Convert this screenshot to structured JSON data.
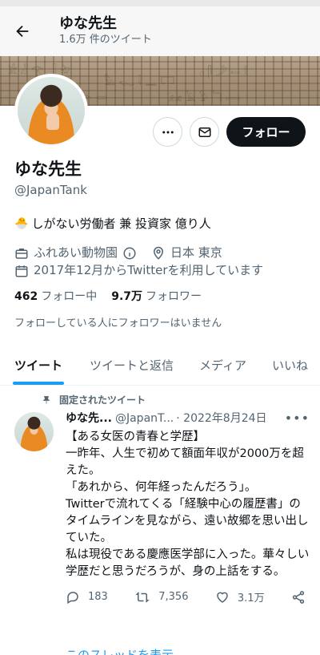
{
  "header": {
    "name": "ゆな先生",
    "tweet_count": "1.6万 件のツイート"
  },
  "profile": {
    "display_name": "ゆな先生",
    "handle": "@JapanTank",
    "bio": "しがない労働者 兼 投資家 億り人",
    "workplace": "ふれあい動物園",
    "location": "日本 東京",
    "joined": "2017年12月からTwitterを利用しています",
    "following_count": "462",
    "following_label": "フォロー中",
    "followers_count": "9.7万",
    "followers_label": "フォロワー",
    "known_followers": "フォローしている人にフォロワーはいません"
  },
  "actions": {
    "follow_label": "フォロー",
    "more_icon": "more-icon",
    "mail_icon": "mail-icon"
  },
  "tabs": [
    {
      "label": "ツイート"
    },
    {
      "label": "ツイートと返信"
    },
    {
      "label": "メディア"
    },
    {
      "label": "いいね"
    }
  ],
  "tweet": {
    "pinned_label": "固定されたツイート",
    "author": "ゆな先...",
    "handle": "@JapanT...",
    "date": "· 2022年8月24日",
    "lines": [
      "【ある女医の青春と学歴】",
      "一昨年、人生で初めて額面年収が2000万を超えた。",
      "「あれから、何年経ったんだろう」。",
      "Twitterで流れてくる「経験中心の履歴書」のタイムラインを見ながら、遠い故郷を思い出していた。",
      "私は現役である慶應医学部に入った。華々しい学歴だと思うだろうが、身の上話をする。"
    ],
    "replies": "183",
    "retweets": "7,356",
    "likes": "3.1万",
    "thread_link": "このスレッドを表示"
  },
  "colors": {
    "accent": "#1d9bf0",
    "text": "#0f1419",
    "secondary": "#536471"
  }
}
